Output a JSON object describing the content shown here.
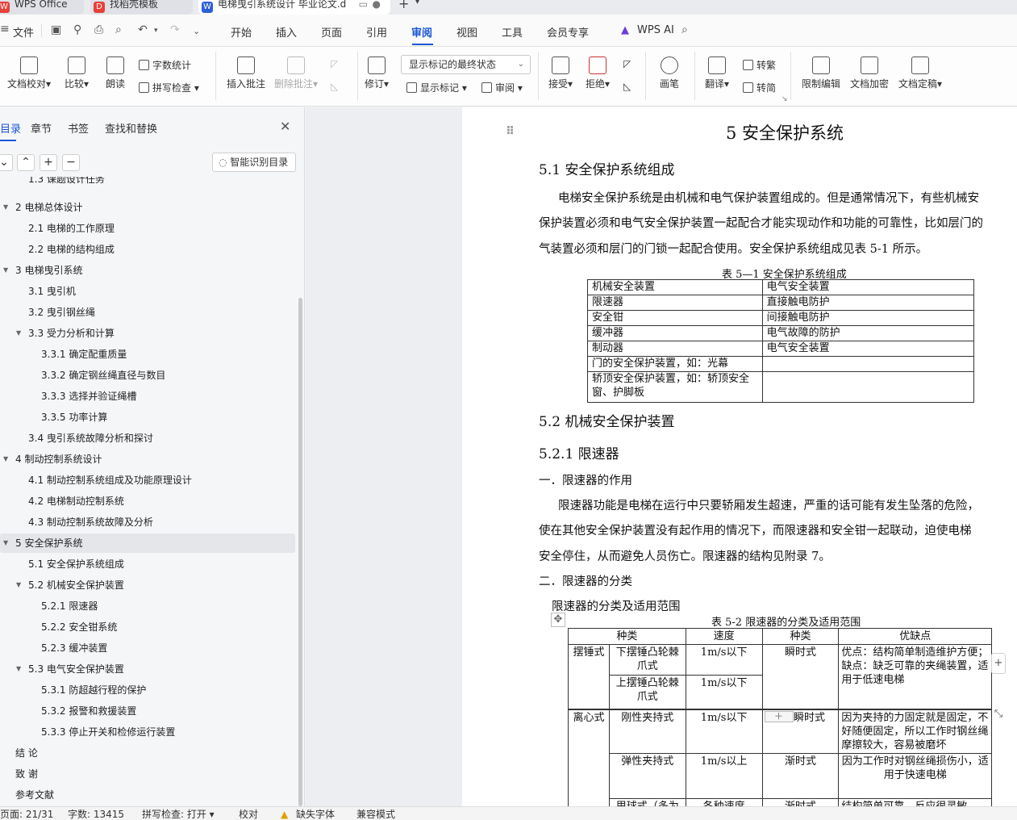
{
  "tabs": [
    {
      "label": "WPS Office",
      "icon": "wps-logo-icon",
      "color": "#e8403a"
    },
    {
      "label": "找稻壳模板",
      "icon": "daoke-logo-icon",
      "color": "#e8403a"
    },
    {
      "label": "电梯曳引系统设计 毕业论文.d",
      "icon": "word-doc-icon",
      "color": "#2b5fd9"
    }
  ],
  "menu": {
    "file": "文件",
    "items": [
      "开始",
      "插入",
      "页面",
      "引用",
      "审阅",
      "视图",
      "工具",
      "会员专享"
    ],
    "active": "审阅",
    "wps_ai": "WPS AI"
  },
  "ribbon": {
    "doc_check": "文档校对",
    "compare": "比较",
    "read_aloud": "朗读",
    "word_count": "字数统计",
    "spell_check": "拼写检查",
    "insert_comment": "插入批注",
    "delete_comment": "删除批注",
    "revise": "修订",
    "markup_dropdown": "显示标记的最终状态",
    "show_markup": "显示标记",
    "review": "审阅",
    "accept": "接受",
    "reject": "拒绝",
    "pen": "画笔",
    "translate": "翻译",
    "to_traditional": "转繁",
    "to_simplified": "转简",
    "restrict_edit": "限制编辑",
    "doc_encrypt": "文档加密",
    "doc_finalize": "文档定稿"
  },
  "nav": {
    "tabs": [
      "目录",
      "章节",
      "书签",
      "查找和替换"
    ],
    "smart_toc": "智能识别目录",
    "items": [
      {
        "label": "1.3 课题设计任务",
        "level": 2
      },
      {
        "label": "2  电梯总体设计",
        "level": 1,
        "expanded": true
      },
      {
        "label": "2.1   电梯的工作原理",
        "level": 2
      },
      {
        "label": "2.2   电梯的结构组成",
        "level": 2
      },
      {
        "label": "3 电梯曳引系统",
        "level": 1,
        "expanded": true
      },
      {
        "label": "3.1 曳引机",
        "level": 2
      },
      {
        "label": "3.2  曳引钢丝绳",
        "level": 2
      },
      {
        "label": "3.3  受力分析和计算",
        "level": 2,
        "expanded": true
      },
      {
        "label": "3.3.1  确定配重质量",
        "level": 3
      },
      {
        "label": "3.3.2 确定钢丝绳直径与数目",
        "level": 3
      },
      {
        "label": "3.3.3 选择并验证绳槽",
        "level": 3
      },
      {
        "label": "3.3.5 功率计算",
        "level": 3
      },
      {
        "label": "3.4  曳引系统故障分析和探讨",
        "level": 2
      },
      {
        "label": "4 制动控制系统设计",
        "level": 1,
        "expanded": true
      },
      {
        "label": "4.1 制动控制系统组成及功能原理设计",
        "level": 2
      },
      {
        "label": "4.2 电梯制动控制系统",
        "level": 2
      },
      {
        "label": "4.3 制动控制系统故障及分析",
        "level": 2
      },
      {
        "label": "5 安全保护系统",
        "level": 1,
        "expanded": true,
        "selected": true
      },
      {
        "label": "5.1  安全保护系统组成",
        "level": 2
      },
      {
        "label": "5.2 机械安全保护装置",
        "level": 2,
        "expanded": true
      },
      {
        "label": "5.2.1  限速器",
        "level": 3
      },
      {
        "label": "5.2.2  安全钳系统",
        "level": 3
      },
      {
        "label": "5.2.3  缓冲装置",
        "level": 3
      },
      {
        "label": "5.3  电气安全保护装置",
        "level": 2,
        "expanded": true
      },
      {
        "label": "5.3.1 防超越行程的保护",
        "level": 3
      },
      {
        "label": "5.3.2 报警和救援装置",
        "level": 3
      },
      {
        "label": "5.3.3 停止开关和检修运行装置",
        "level": 3
      },
      {
        "label": "结    论",
        "level": 1
      },
      {
        "label": "致    谢",
        "level": 1
      },
      {
        "label": "参考文献",
        "level": 1
      }
    ]
  },
  "doc": {
    "title": "5 安全保护系统",
    "s51": "5.1  安全保护系统组成",
    "p1_l1": "电梯安全保护系统是由机械和电气保护装置组成的。但是通常情况下，有些机械安",
    "p1_l2": "保护装置必须和电气安全保护装置一起配合才能实现动作和功能的可靠性，比如层门的",
    "p1_l3": "气装置必须和层门的门锁一起配合使用。安全保护系统组成见表 5-1 所示。",
    "t1_caption": "表 5—1  安全保护系统组成",
    "t1_rows": [
      [
        "机械安全装置",
        "电气安全装置"
      ],
      [
        "限速器",
        "直接触电防护"
      ],
      [
        "安全钳",
        "间接触电防护"
      ],
      [
        "缓冲器",
        "电气故障的防护"
      ],
      [
        "制动器",
        "电气安全装置"
      ],
      [
        "门的安全保护装置，如：光幕",
        ""
      ],
      [
        "轿顶安全保护装置，如：轿顶安全窗、护脚板",
        ""
      ]
    ],
    "s52": "5.2 机械安全保护装置",
    "s521": "5.2.1  限速器",
    "sub1": "一．限速器的作用",
    "p2_l1": "限速器功能是电梯在运行中只要轿厢发生超速，严重的话可能有发生坠落的危险，",
    "p2_l2": "使在其他安全保护装置没有起作用的情况下，而限速器和安全钳一起联动，迫使电梯",
    "p2_l3": "安全停住，从而避免人员伤亡。限速器的结构见附录 7。",
    "sub2": "二．限速器的分类",
    "p3": "限速器的分类及适用范围",
    "t2_caption": "表 5-2 限速器的分类及适用范围",
    "t2_headers": [
      "种类",
      "速度",
      "种类",
      "优缺点"
    ],
    "t2_rows": {
      "g1": "摆锤式",
      "r1a": "下摆锤凸轮棘爪式",
      "r1a_speed": "1m/s以下",
      "r1b": "上摆锤凸轮棘爪式",
      "r1b_speed": "1m/s以下",
      "r1_type": "瞬时式",
      "r1_note": "优点：结构简单制造维护方便；缺点：缺乏可靠的夹绳装置，适用于低速电梯",
      "g2": "离心式",
      "r2a": "刚性夹持式",
      "r2a_speed": "1m/s以下",
      "r2a_type": "瞬时式",
      "r2a_note": "因为夹持的力固定就是固定，不好随便固定，所以工作时钢丝绳摩擦较大，容易被磨坏",
      "r2b": "弹性夹持式",
      "r2b_speed": "1m/s以上",
      "r2b_type": "渐时式",
      "r2b_note": "因为工作时对钢丝绳损伤小，适用于快速电梯",
      "r2c": "甩球式（多为",
      "r2c_speed": "各种速度",
      "r2c_type": "渐时式",
      "r2c_note": "结构简单可靠，反应很灵敏，"
    }
  },
  "status": {
    "page": "页面: 21/31",
    "words": "字数: 13415",
    "spell": "拼写检查: 打开",
    "proof": "校对",
    "missing_font": "缺失字体",
    "compat": "兼容模式"
  }
}
